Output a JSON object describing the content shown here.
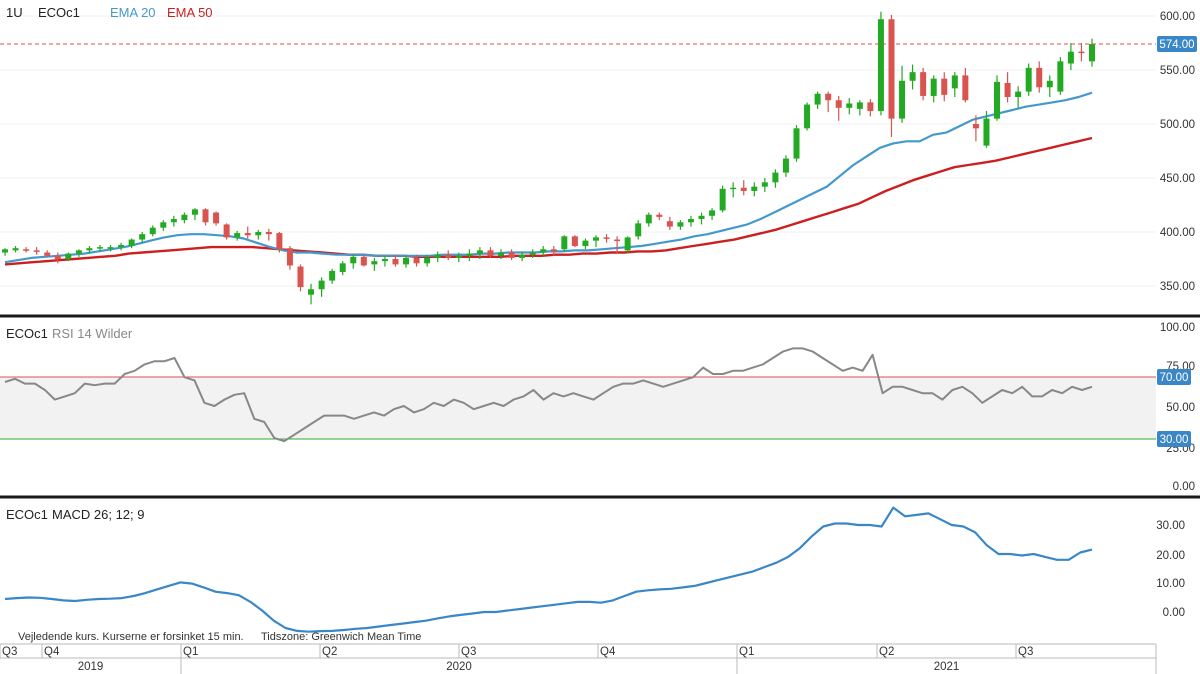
{
  "header": {
    "timeframe": "1U",
    "symbol": "ECOc1",
    "ema20_label": "EMA 20",
    "ema50_label": "EMA 50"
  },
  "price_axis": {
    "ticks": [
      "600.00",
      "550.00",
      "500.00",
      "450.00",
      "400.00",
      "350.00"
    ],
    "last_price_tag": "574.00"
  },
  "rsi": {
    "symbol": "ECOc1",
    "label": "RSI 14 Wilder",
    "ticks": [
      "100.00",
      "75.00",
      "50.00",
      "25.00",
      "0.00"
    ],
    "upper_tag": "70.00",
    "lower_tag": "30.00"
  },
  "macd": {
    "symbol": "ECOc1",
    "label": "MACD 26; 12; 9",
    "ticks": [
      "30.00",
      "20.00",
      "10.00",
      "0.00"
    ]
  },
  "footer": {
    "disclaimer": "Vejledende kurs. Kurserne er forsinket 15 min.",
    "timezone": "Tidszone: Greenwich Mean Time"
  },
  "time_axis": {
    "quarters": [
      "Q3",
      "Q4",
      "Q1",
      "Q2",
      "Q3",
      "Q4",
      "Q1",
      "Q2",
      "Q3"
    ],
    "years": [
      "2019",
      "2020",
      "2021"
    ]
  },
  "colors": {
    "up": "#22aa22",
    "down": "#d9534f",
    "ema20": "#4499cc",
    "ema50": "#cc1f1f",
    "rsi_line": "#888888",
    "rsi_upper": "#d9534f",
    "rsi_lower": "#33aa33",
    "macd_line": "#3a87c8",
    "tag_bg": "#3a87c8"
  },
  "chart_data": [
    {
      "type": "candlestick",
      "title": "ECOc1",
      "interval": "1U",
      "ylim": [
        325,
        610
      ],
      "series": [
        {
          "name": "EMA 20",
          "values": [
            372,
            374,
            376,
            377,
            378,
            379,
            380,
            382,
            384,
            386,
            389,
            392,
            395,
            397,
            398,
            398,
            397,
            396,
            394,
            390,
            386,
            383,
            381,
            381,
            380,
            379,
            379,
            379,
            378,
            378,
            378,
            378,
            378,
            379,
            379,
            379,
            380,
            380,
            381,
            381,
            381,
            382,
            382,
            383,
            383,
            384,
            385,
            386,
            387,
            389,
            391,
            393,
            396,
            398,
            401,
            404,
            407,
            412,
            418,
            424,
            430,
            436,
            442,
            452,
            462,
            470,
            478,
            482,
            484,
            484,
            490,
            492,
            498,
            504,
            507,
            510,
            513,
            516,
            518,
            520,
            522,
            525,
            529
          ]
        },
        {
          "name": "EMA 50",
          "values": [
            370,
            371,
            372,
            373,
            374,
            375,
            376,
            377,
            378,
            380,
            381,
            382,
            383,
            384,
            385,
            386,
            386,
            386,
            386,
            385,
            384,
            383,
            382,
            381,
            380,
            379,
            379,
            378,
            378,
            378,
            377,
            377,
            377,
            377,
            377,
            377,
            377,
            378,
            378,
            378,
            379,
            379,
            380,
            380,
            381,
            381,
            382,
            382,
            383,
            385,
            387,
            389,
            391,
            393,
            396,
            399,
            402,
            406,
            410,
            414,
            418,
            422,
            426,
            432,
            438,
            443,
            448,
            452,
            456,
            460,
            462,
            464,
            466,
            469,
            472,
            475,
            478,
            481,
            484,
            487
          ]
        }
      ],
      "candles": [
        {
          "o": 381,
          "h": 385,
          "l": 378,
          "c": 384
        },
        {
          "o": 383,
          "h": 387,
          "l": 381,
          "c": 385
        },
        {
          "o": 384,
          "h": 386,
          "l": 381,
          "c": 383
        },
        {
          "o": 383,
          "h": 386,
          "l": 379,
          "c": 382
        },
        {
          "o": 381,
          "h": 383,
          "l": 377,
          "c": 378
        },
        {
          "o": 378,
          "h": 381,
          "l": 371,
          "c": 375
        },
        {
          "o": 375,
          "h": 381,
          "l": 373,
          "c": 380
        },
        {
          "o": 380,
          "h": 384,
          "l": 377,
          "c": 383
        },
        {
          "o": 383,
          "h": 387,
          "l": 380,
          "c": 385
        },
        {
          "o": 385,
          "h": 388,
          "l": 382,
          "c": 386
        },
        {
          "o": 385,
          "h": 388,
          "l": 382,
          "c": 386
        },
        {
          "o": 386,
          "h": 390,
          "l": 383,
          "c": 388
        },
        {
          "o": 387,
          "h": 394,
          "l": 385,
          "c": 393
        },
        {
          "o": 393,
          "h": 400,
          "l": 390,
          "c": 398
        },
        {
          "o": 398,
          "h": 406,
          "l": 396,
          "c": 404
        },
        {
          "o": 404,
          "h": 411,
          "l": 401,
          "c": 409
        },
        {
          "o": 409,
          "h": 415,
          "l": 405,
          "c": 412
        },
        {
          "o": 411,
          "h": 418,
          "l": 408,
          "c": 416
        },
        {
          "o": 416,
          "h": 422,
          "l": 411,
          "c": 421
        },
        {
          "o": 421,
          "h": 422,
          "l": 406,
          "c": 409
        },
        {
          "o": 418,
          "h": 419,
          "l": 406,
          "c": 408
        },
        {
          "o": 407,
          "h": 408,
          "l": 393,
          "c": 395
        },
        {
          "o": 395,
          "h": 401,
          "l": 392,
          "c": 399
        },
        {
          "o": 399,
          "h": 405,
          "l": 394,
          "c": 397
        },
        {
          "o": 397,
          "h": 402,
          "l": 393,
          "c": 400
        },
        {
          "o": 400,
          "h": 403,
          "l": 392,
          "c": 398
        },
        {
          "o": 399,
          "h": 400,
          "l": 381,
          "c": 384
        },
        {
          "o": 385,
          "h": 387,
          "l": 365,
          "c": 369
        },
        {
          "o": 368,
          "h": 370,
          "l": 345,
          "c": 349
        },
        {
          "o": 342,
          "h": 352,
          "l": 333,
          "c": 347
        },
        {
          "o": 347,
          "h": 358,
          "l": 340,
          "c": 355
        },
        {
          "o": 355,
          "h": 366,
          "l": 352,
          "c": 364
        },
        {
          "o": 363,
          "h": 373,
          "l": 360,
          "c": 371
        },
        {
          "o": 371,
          "h": 379,
          "l": 366,
          "c": 377
        },
        {
          "o": 377,
          "h": 378,
          "l": 368,
          "c": 369
        },
        {
          "o": 370,
          "h": 376,
          "l": 364,
          "c": 373
        },
        {
          "o": 373,
          "h": 378,
          "l": 368,
          "c": 375
        },
        {
          "o": 375,
          "h": 379,
          "l": 368,
          "c": 370
        },
        {
          "o": 370,
          "h": 378,
          "l": 367,
          "c": 376
        },
        {
          "o": 376,
          "h": 379,
          "l": 368,
          "c": 371
        },
        {
          "o": 371,
          "h": 379,
          "l": 368,
          "c": 376
        },
        {
          "o": 376,
          "h": 382,
          "l": 372,
          "c": 379
        },
        {
          "o": 379,
          "h": 383,
          "l": 374,
          "c": 376
        },
        {
          "o": 376,
          "h": 381,
          "l": 372,
          "c": 378
        },
        {
          "o": 378,
          "h": 384,
          "l": 373,
          "c": 380
        },
        {
          "o": 380,
          "h": 386,
          "l": 375,
          "c": 383
        },
        {
          "o": 383,
          "h": 386,
          "l": 376,
          "c": 378
        },
        {
          "o": 378,
          "h": 384,
          "l": 375,
          "c": 381
        },
        {
          "o": 381,
          "h": 384,
          "l": 374,
          "c": 376
        },
        {
          "o": 376,
          "h": 382,
          "l": 373,
          "c": 379
        },
        {
          "o": 379,
          "h": 384,
          "l": 376,
          "c": 381
        },
        {
          "o": 381,
          "h": 387,
          "l": 378,
          "c": 384
        },
        {
          "o": 384,
          "h": 387,
          "l": 378,
          "c": 382
        },
        {
          "o": 384,
          "h": 397,
          "l": 382,
          "c": 396
        },
        {
          "o": 396,
          "h": 397,
          "l": 386,
          "c": 387
        },
        {
          "o": 387,
          "h": 394,
          "l": 384,
          "c": 392
        },
        {
          "o": 392,
          "h": 397,
          "l": 386,
          "c": 395
        },
        {
          "o": 395,
          "h": 398,
          "l": 390,
          "c": 394
        },
        {
          "o": 393,
          "h": 396,
          "l": 380,
          "c": 392
        },
        {
          "o": 383,
          "h": 396,
          "l": 380,
          "c": 395
        },
        {
          "o": 396,
          "h": 411,
          "l": 393,
          "c": 408
        },
        {
          "o": 408,
          "h": 418,
          "l": 405,
          "c": 416
        },
        {
          "o": 416,
          "h": 418,
          "l": 411,
          "c": 414
        },
        {
          "o": 410,
          "h": 414,
          "l": 402,
          "c": 405
        },
        {
          "o": 405,
          "h": 411,
          "l": 402,
          "c": 409
        },
        {
          "o": 409,
          "h": 415,
          "l": 405,
          "c": 412
        },
        {
          "o": 412,
          "h": 418,
          "l": 407,
          "c": 415
        },
        {
          "o": 415,
          "h": 422,
          "l": 411,
          "c": 420
        },
        {
          "o": 420,
          "h": 443,
          "l": 418,
          "c": 440
        },
        {
          "o": 440,
          "h": 446,
          "l": 432,
          "c": 441
        },
        {
          "o": 441,
          "h": 448,
          "l": 434,
          "c": 438
        },
        {
          "o": 438,
          "h": 446,
          "l": 433,
          "c": 442
        },
        {
          "o": 442,
          "h": 450,
          "l": 437,
          "c": 446
        },
        {
          "o": 446,
          "h": 458,
          "l": 441,
          "c": 455
        },
        {
          "o": 455,
          "h": 471,
          "l": 451,
          "c": 468
        },
        {
          "o": 468,
          "h": 499,
          "l": 465,
          "c": 496
        },
        {
          "o": 496,
          "h": 520,
          "l": 494,
          "c": 518
        },
        {
          "o": 518,
          "h": 530,
          "l": 514,
          "c": 528
        },
        {
          "o": 528,
          "h": 530,
          "l": 511,
          "c": 522
        },
        {
          "o": 522,
          "h": 526,
          "l": 503,
          "c": 515
        },
        {
          "o": 515,
          "h": 524,
          "l": 509,
          "c": 519
        },
        {
          "o": 514,
          "h": 522,
          "l": 508,
          "c": 520
        },
        {
          "o": 520,
          "h": 523,
          "l": 507,
          "c": 512
        },
        {
          "o": 512,
          "h": 604,
          "l": 508,
          "c": 597
        },
        {
          "o": 597,
          "h": 601,
          "l": 488,
          "c": 505
        },
        {
          "o": 505,
          "h": 554,
          "l": 501,
          "c": 540
        },
        {
          "o": 540,
          "h": 555,
          "l": 532,
          "c": 548
        },
        {
          "o": 548,
          "h": 552,
          "l": 522,
          "c": 526
        },
        {
          "o": 526,
          "h": 545,
          "l": 520,
          "c": 542
        },
        {
          "o": 542,
          "h": 548,
          "l": 521,
          "c": 527
        },
        {
          "o": 533,
          "h": 548,
          "l": 525,
          "c": 545
        },
        {
          "o": 545,
          "h": 552,
          "l": 520,
          "c": 522
        },
        {
          "o": 500,
          "h": 508,
          "l": 484,
          "c": 496
        },
        {
          "o": 480,
          "h": 512,
          "l": 478,
          "c": 505
        },
        {
          "o": 505,
          "h": 545,
          "l": 503,
          "c": 539
        },
        {
          "o": 538,
          "h": 548,
          "l": 520,
          "c": 525
        },
        {
          "o": 525,
          "h": 535,
          "l": 515,
          "c": 530
        },
        {
          "o": 530,
          "h": 556,
          "l": 526,
          "c": 552
        },
        {
          "o": 552,
          "h": 558,
          "l": 529,
          "c": 534
        },
        {
          "o": 534,
          "h": 545,
          "l": 525,
          "c": 540
        },
        {
          "o": 530,
          "h": 562,
          "l": 527,
          "c": 558
        },
        {
          "o": 556,
          "h": 575,
          "l": 550,
          "c": 567
        },
        {
          "o": 567,
          "h": 575,
          "l": 558,
          "c": 566
        },
        {
          "o": 558,
          "h": 579,
          "l": 553,
          "c": 574
        }
      ]
    },
    {
      "type": "line",
      "title": "RSI 14 Wilder",
      "ylim": [
        0,
        100
      ],
      "reference_lines": [
        70,
        30
      ],
      "series": [
        {
          "name": "RSI 14 Wilder",
          "values": [
            65,
            67,
            64,
            64,
            60,
            54,
            56,
            58,
            64,
            63,
            64,
            64,
            70,
            72,
            76,
            78,
            78,
            80,
            68,
            66,
            52,
            50,
            54,
            57,
            58,
            42,
            40,
            30,
            28,
            32,
            36,
            40,
            44,
            44,
            44,
            42,
            44,
            46,
            44,
            48,
            50,
            46,
            48,
            52,
            50,
            54,
            52,
            48,
            50,
            52,
            50,
            54,
            56,
            60,
            54,
            58,
            56,
            58,
            56,
            54,
            58,
            62,
            64,
            64,
            66,
            64,
            62,
            64,
            66,
            68,
            74,
            70,
            70,
            72,
            72,
            74,
            76,
            80,
            84,
            86,
            86,
            84,
            80,
            76,
            72,
            74,
            72,
            82,
            58,
            62,
            62,
            60,
            58,
            58,
            54,
            60,
            62,
            58,
            52,
            56,
            60,
            58,
            62,
            56,
            56,
            60,
            58,
            62,
            60,
            62
          ]
        }
      ]
    },
    {
      "type": "line",
      "title": "MACD 26; 12; 9",
      "ylim": [
        -10,
        37
      ],
      "series": [
        {
          "name": "MACD",
          "values": [
            4.5,
            4.8,
            5.0,
            4.9,
            4.5,
            4.0,
            3.8,
            4.2,
            4.5,
            4.6,
            4.8,
            5.5,
            6.5,
            7.8,
            9.0,
            10.2,
            9.8,
            8.5,
            7.0,
            6.5,
            5.8,
            3.5,
            0.5,
            -3.0,
            -5.5,
            -6.5,
            -6.8,
            -6.6,
            -6.5,
            -6.2,
            -5.8,
            -5.5,
            -5.0,
            -4.5,
            -4.0,
            -3.5,
            -3.0,
            -2.2,
            -1.5,
            -1.0,
            -0.5,
            0.0,
            0.0,
            0.5,
            1.0,
            1.5,
            2.0,
            2.5,
            3.0,
            3.5,
            3.5,
            3.2,
            4.0,
            5.5,
            7.0,
            7.5,
            7.8,
            8.0,
            8.5,
            9.0,
            10.0,
            11.0,
            12.0,
            13.0,
            14.0,
            15.5,
            17.0,
            19.0,
            22.0,
            26.0,
            29.5,
            30.5,
            30.5,
            30.0,
            30.0,
            29.5,
            36.0,
            33.0,
            33.5,
            34.0,
            32.0,
            30.0,
            29.5,
            27.5,
            23.0,
            20.0,
            20.0,
            19.5,
            20.0,
            19.0,
            18.0,
            18.0,
            20.5,
            21.5
          ]
        }
      ]
    }
  ]
}
